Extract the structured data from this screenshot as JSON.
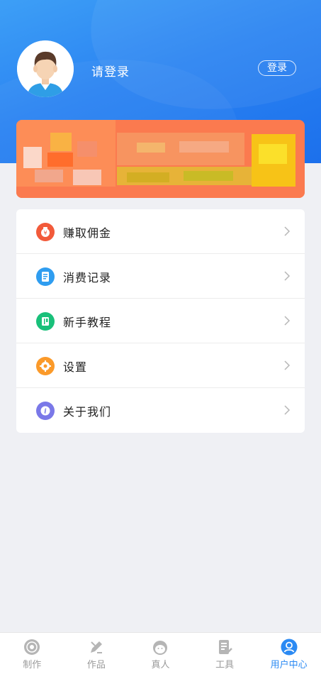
{
  "header": {
    "username": "请登录",
    "login_label": "登录"
  },
  "menu": {
    "items": [
      {
        "label": "赚取佣金",
        "icon": "money-bag-icon",
        "color": "#f25a3a"
      },
      {
        "label": "消费记录",
        "icon": "receipt-icon",
        "color": "#2f9df0"
      },
      {
        "label": "新手教程",
        "icon": "book-icon",
        "color": "#19c07a"
      },
      {
        "label": "设置",
        "icon": "gear-icon",
        "color": "#fb9a2a"
      },
      {
        "label": "关于我们",
        "icon": "info-icon",
        "color": "#7a78e8"
      }
    ]
  },
  "tabbar": {
    "items": [
      {
        "label": "制作",
        "icon": "record-icon"
      },
      {
        "label": "作品",
        "icon": "edit-icon"
      },
      {
        "label": "真人",
        "icon": "person-face-icon"
      },
      {
        "label": "工具",
        "icon": "document-tool-icon"
      },
      {
        "label": "用户中心",
        "icon": "user-icon",
        "active": true
      }
    ]
  },
  "colors": {
    "brand_blue": "#2b84f2",
    "active_tab": "#2b8af3",
    "banner": "#fb7a4f"
  }
}
